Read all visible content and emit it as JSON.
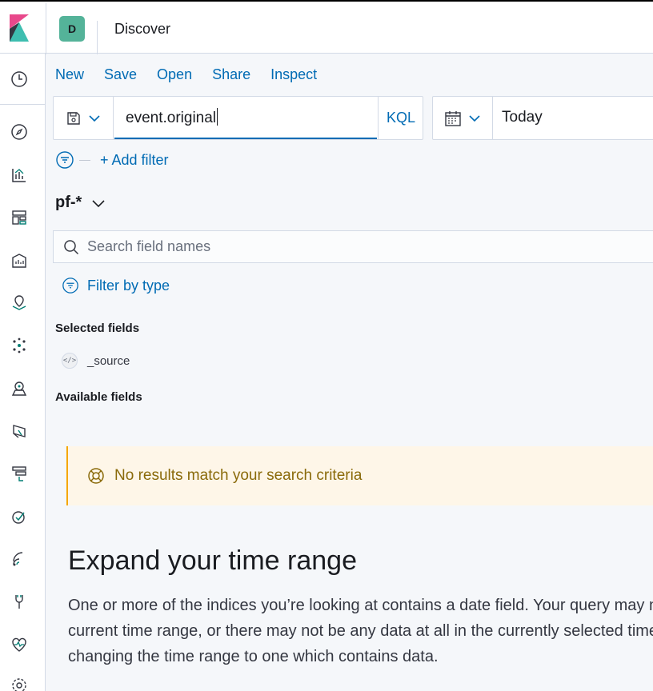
{
  "header": {
    "avatar_letter": "D",
    "breadcrumb": "Discover"
  },
  "nav": {
    "icons": [
      "clock-icon",
      "compass-icon",
      "visualize-icon",
      "dashboard-icon",
      "canvas-icon",
      "maps-icon",
      "ml-icon",
      "infra-icon",
      "logs-icon",
      "apm-icon",
      "uptime-icon",
      "siem-icon",
      "dev-tools-icon",
      "monitoring-icon",
      "management-icon"
    ]
  },
  "top_menu": {
    "new": "New",
    "save": "Save",
    "open": "Open",
    "share": "Share",
    "inspect": "Inspect"
  },
  "query": {
    "value": "event.original",
    "language": "KQL"
  },
  "time": {
    "value": "Today"
  },
  "filters": {
    "add_label": "+ Add filter"
  },
  "index_pattern": {
    "name": "pf-*"
  },
  "field_search": {
    "placeholder": "Search field names"
  },
  "filter_by_type": "Filter by type",
  "selected_fields": {
    "title": "Selected fields",
    "items": [
      {
        "name": "_source",
        "token": "</>"
      }
    ]
  },
  "available_fields": {
    "title": "Available fields"
  },
  "callout": {
    "text": "No results match your search criteria"
  },
  "empty_state": {
    "title": "Expand your time range",
    "lines": [
      "One or more of the indices you’re looking at contains a date field. Your query may not match anything in the",
      "current time range, or there may not be any data at all in the currently selected time range. You can try",
      "changing the time range to one which contains data."
    ]
  },
  "colors": {
    "link": "#006bb4",
    "avatar": "#54b399",
    "callout_bg": "#fef6e8",
    "callout_border": "#f5a700"
  }
}
